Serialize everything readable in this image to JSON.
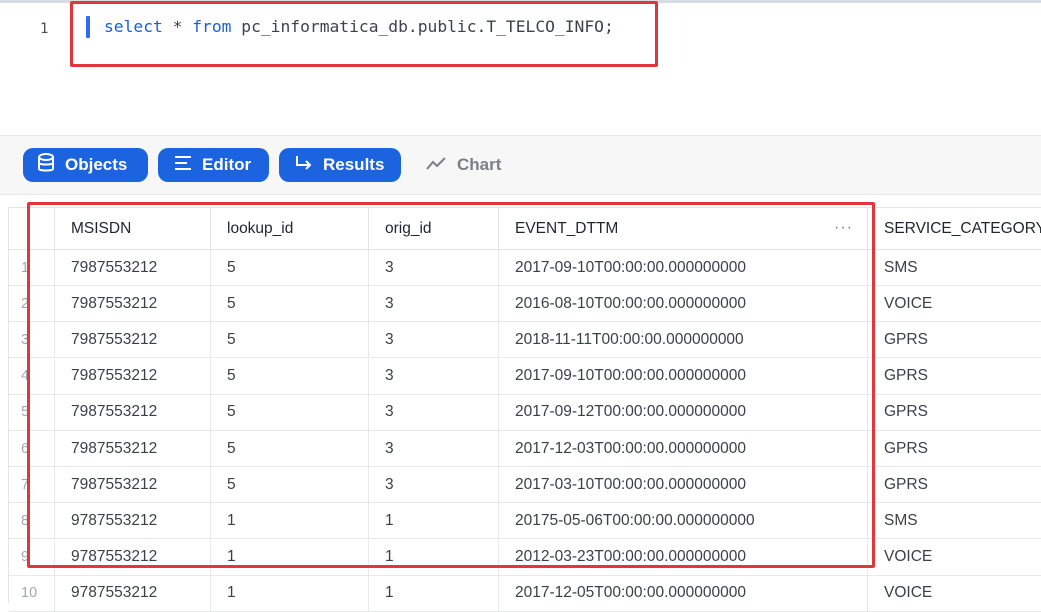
{
  "editor": {
    "line_number": "1",
    "code_keyword1": "select",
    "code_mid": " * ",
    "code_keyword2": "from",
    "code_rest": " pc_informatica_db.public.T_TELCO_INFO;"
  },
  "toolbar": {
    "objects_label": "Objects",
    "editor_label": "Editor",
    "results_label": "Results",
    "chart_label": "Chart"
  },
  "results": {
    "columns": [
      "MSISDN",
      "lookup_id",
      "orig_id",
      "EVENT_DTTM",
      "SERVICE_CATEGORY"
    ],
    "column_menu_glyph": "···",
    "rows": [
      [
        "1",
        "7987553212",
        "5",
        "3",
        "2017-09-10T00:00:00.000000000",
        "SMS"
      ],
      [
        "2",
        "7987553212",
        "5",
        "3",
        "2016-08-10T00:00:00.000000000",
        "VOICE"
      ],
      [
        "3",
        "7987553212",
        "5",
        "3",
        "2018-11-11T00:00:00.000000000",
        "GPRS"
      ],
      [
        "4",
        "7987553212",
        "5",
        "3",
        "2017-09-10T00:00:00.000000000",
        "GPRS"
      ],
      [
        "5",
        "7987553212",
        "5",
        "3",
        "2017-09-12T00:00:00.000000000",
        "GPRS"
      ],
      [
        "6",
        "7987553212",
        "5",
        "3",
        "2017-12-03T00:00:00.000000000",
        "GPRS"
      ],
      [
        "7",
        "7987553212",
        "5",
        "3",
        "2017-03-10T00:00:00.000000000",
        "GPRS"
      ],
      [
        "8",
        "9787553212",
        "1",
        "1",
        "20175-05-06T00:00:00.000000000",
        "SMS"
      ],
      [
        "9",
        "9787553212",
        "1",
        "1",
        "2012-03-23T00:00:00.000000000",
        "VOICE"
      ],
      [
        "10",
        "9787553212",
        "1",
        "1",
        "2017-12-05T00:00:00.000000000",
        "VOICE"
      ]
    ]
  },
  "icons": {
    "objects": "database-icon",
    "editor": "lines-icon",
    "results": "arrow-return-icon",
    "chart": "line-chart-icon"
  },
  "colors": {
    "accent": "#1b63df",
    "highlight": "#e2363d",
    "keyword": "#1a5fd8"
  }
}
